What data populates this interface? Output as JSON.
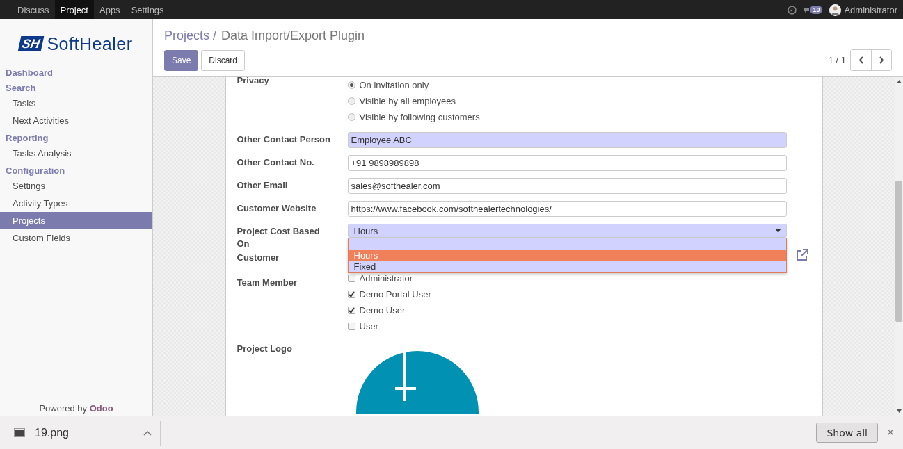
{
  "topbar": {
    "menu": [
      {
        "label": "Discuss",
        "selected": false
      },
      {
        "label": "Project",
        "selected": true
      },
      {
        "label": "Apps",
        "selected": false
      },
      {
        "label": "Settings",
        "selected": false
      }
    ],
    "message_count": "10",
    "user": "Administrator"
  },
  "sidebar": {
    "logo": {
      "mark": "SH",
      "text": "SoftHealer"
    },
    "sections": [
      {
        "title": "Dashboard"
      },
      {
        "title": "Search",
        "items": [
          {
            "label": "Tasks",
            "selected": false
          },
          {
            "label": "Next Activities",
            "selected": false
          }
        ]
      },
      {
        "title": "Reporting",
        "items": [
          {
            "label": "Tasks Analysis",
            "selected": false
          }
        ]
      },
      {
        "title": "Configuration",
        "items": [
          {
            "label": "Settings",
            "selected": false
          },
          {
            "label": "Activity Types",
            "selected": false
          },
          {
            "label": "Projects",
            "selected": true
          },
          {
            "label": "Custom Fields",
            "selected": false
          }
        ]
      }
    ],
    "footer": "Powered by **Odoo**"
  },
  "control_panel": {
    "breadcrumb": {
      "parent": "Projects /",
      "current": "Data Import/Export Plugin"
    },
    "buttons": [
      {
        "label": "Save",
        "kind": "primary"
      },
      {
        "label": "Discard",
        "kind": "secondary"
      }
    ],
    "pager": "1 / 1"
  },
  "form": {
    "rows": [
      {
        "kind": "radio",
        "label": "Privacy",
        "options": [
          {
            "label": "On invitation only",
            "selected": true
          },
          {
            "label": "Visible by all employees",
            "selected": false
          },
          {
            "label": "Visible by following customers",
            "selected": false
          }
        ]
      },
      {
        "kind": "text",
        "label": "Other Contact Person",
        "value": "Employee ABC",
        "required": true
      },
      {
        "kind": "text",
        "label": "Other Contact No.",
        "value": "+91 9898989898",
        "required": false
      },
      {
        "kind": "text",
        "label": "Other Email",
        "value": "sales@softhealer.com",
        "required": false
      },
      {
        "kind": "text",
        "label": "Customer Website",
        "value": "https://www.facebook.com/softhealertechnologies/",
        "required": false
      },
      {
        "kind": "select",
        "label": "Project Cost Based On",
        "value": "Hours",
        "expanded": true,
        "options": [
          {
            "label": "Hours",
            "selected": true
          },
          {
            "label": "Fixed",
            "selected": false
          }
        ]
      },
      {
        "kind": "link",
        "label": "Customer"
      },
      {
        "kind": "checkboxes",
        "label": "Team Member",
        "options": [
          {
            "label": "Administrator",
            "checked": false
          },
          {
            "label": "Demo Portal User",
            "checked": true
          },
          {
            "label": "Demo User",
            "checked": true
          },
          {
            "label": "User",
            "checked": false
          }
        ]
      },
      {
        "kind": "image",
        "label": "Project Logo"
      }
    ]
  },
  "downloads": {
    "file": "19.png",
    "show_all": "Show all",
    "close": "×"
  }
}
